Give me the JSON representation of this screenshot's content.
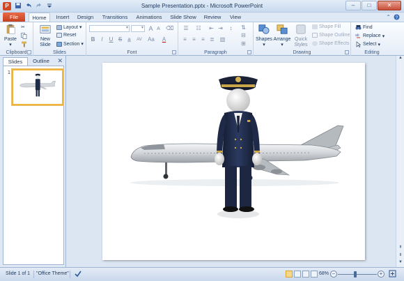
{
  "window": {
    "title": "Sample Presentation.pptx - Microsoft PowerPoint",
    "app_icon_letter": "P",
    "controls": {
      "minimize": "–",
      "maximize": "□",
      "close": "✕"
    }
  },
  "quick_access": [
    "save-icon",
    "undo-icon",
    "redo-icon",
    "customize-icon"
  ],
  "tabs": {
    "file": "File",
    "items": [
      "Home",
      "Insert",
      "Design",
      "Transitions",
      "Animations",
      "Slide Show",
      "Review",
      "View"
    ],
    "active": "Home"
  },
  "ribbon": {
    "clipboard": {
      "label": "Clipboard",
      "paste": "Paste"
    },
    "slides": {
      "label": "Slides",
      "new_slide": "New Slide",
      "layout": "Layout",
      "reset": "Reset",
      "section": "Section"
    },
    "font": {
      "label": "Font",
      "bold": "B",
      "italic": "I",
      "underline": "U",
      "strike": "S",
      "spacing": "AV",
      "case": "Aa",
      "color": "A",
      "grow": "A",
      "shrink": "A"
    },
    "paragraph": {
      "label": "Paragraph"
    },
    "drawing": {
      "label": "Drawing",
      "shapes": "Shapes",
      "arrange": "Arrange",
      "quick_styles": "Quick Styles",
      "shape_fill": "Shape Fill",
      "shape_outline": "Shape Outline",
      "shape_effects": "Shape Effects"
    },
    "editing": {
      "label": "Editing",
      "find": "Find",
      "replace": "Replace",
      "select": "Select"
    }
  },
  "panel": {
    "tabs": [
      "Slides",
      "Outline"
    ],
    "active_tab": "Slides",
    "close": "✕",
    "slide_number": "1"
  },
  "status": {
    "slide": "Slide 1 of 1",
    "theme": "\"Office Theme\"",
    "zoom": "68%",
    "zoom_level": 0.68
  },
  "colors": {
    "file_tab": "#d24726",
    "accent": "#1e395b",
    "thumb_border": "#f2b33b"
  }
}
